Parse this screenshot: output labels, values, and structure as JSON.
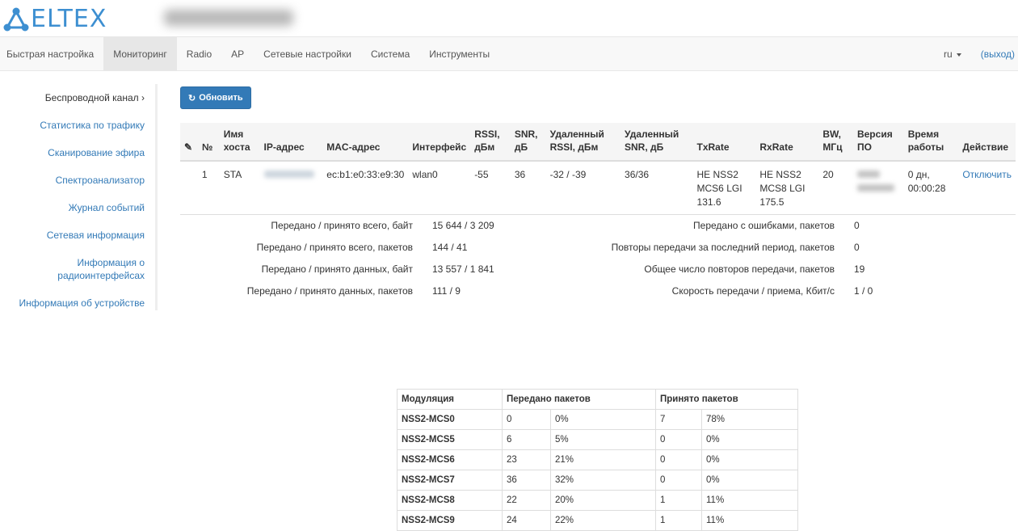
{
  "brand": {
    "logo_text": "ELTEX"
  },
  "nav": {
    "items": [
      "Быстрая настройка",
      "Мониторинг",
      "Radio",
      "AP",
      "Сетевые настройки",
      "Система",
      "Инструменты"
    ],
    "lang": "ru",
    "logout": "(выход)"
  },
  "sidebar": {
    "items": [
      "Беспроводной канал ›",
      "Статистика по трафику",
      "Сканирование эфира",
      "Спектроанализатор",
      "Журнал событий",
      "Сетевая информация",
      "Информация о радиоинтерфейсах",
      "Информация об устройстве"
    ]
  },
  "refresh_label": "Обновить",
  "clients": {
    "headers": [
      "№",
      "Имя хоста",
      "IP-адрес",
      "MAC-адрес",
      "Интерфейс",
      "RSSI, дБм",
      "SNR, дБ",
      "Удаленный RSSI, дБм",
      "Удаленный SNR, дБ",
      "TxRate",
      "RxRate",
      "BW, МГц",
      "Версия ПО",
      "Время работы",
      "Действие"
    ],
    "rows": [
      {
        "num": "1",
        "host": "STA",
        "mac": "ec:b1:e0:33:e9:30",
        "iface": "wlan0",
        "rssi": "-55",
        "snr": "36",
        "remote_rssi": "-32 / -39",
        "remote_snr": "36/36",
        "txrate": "HE NSS2 MCS6 LGI 131.6",
        "rxrate": "HE NSS2 MCS8 LGI 175.5",
        "bw": "20",
        "uptime": "0 дн, 00:00:28",
        "action": "Отключить"
      }
    ]
  },
  "stats": {
    "left": [
      {
        "label": "Передано / принято всего, байт",
        "value": "15 644 / 3 209"
      },
      {
        "label": "Передано / принято всего, пакетов",
        "value": "144 / 41"
      },
      {
        "label": "Передано / принято данных, байт",
        "value": "13 557 / 1 841"
      },
      {
        "label": "Передано / принято данных, пакетов",
        "value": "111 / 9"
      }
    ],
    "right": [
      {
        "label": "Передано с ошибками, пакетов",
        "value": "0"
      },
      {
        "label": "Повторы передачи за последний период, пакетов",
        "value": "0"
      },
      {
        "label": "Общее число повторов передачи, пакетов",
        "value": "19"
      },
      {
        "label": "Скорость передачи / приема, Кбит/с",
        "value": "1 / 0"
      }
    ]
  },
  "modulation": {
    "headers": [
      "Модуляция",
      "Передано пакетов",
      "Принято пакетов"
    ],
    "rows": [
      {
        "name": "NSS2-MCS0",
        "tx": "0",
        "tx_pct": "0%",
        "rx": "7",
        "rx_pct": "78%"
      },
      {
        "name": "NSS2-MCS5",
        "tx": "6",
        "tx_pct": "5%",
        "rx": "0",
        "rx_pct": "0%"
      },
      {
        "name": "NSS2-MCS6",
        "tx": "23",
        "tx_pct": "21%",
        "rx": "0",
        "rx_pct": "0%"
      },
      {
        "name": "NSS2-MCS7",
        "tx": "36",
        "tx_pct": "32%",
        "rx": "0",
        "rx_pct": "0%"
      },
      {
        "name": "NSS2-MCS8",
        "tx": "22",
        "tx_pct": "20%",
        "rx": "1",
        "rx_pct": "11%"
      },
      {
        "name": "NSS2-MCS9",
        "tx": "24",
        "tx_pct": "22%",
        "rx": "1",
        "rx_pct": "11%"
      }
    ]
  }
}
